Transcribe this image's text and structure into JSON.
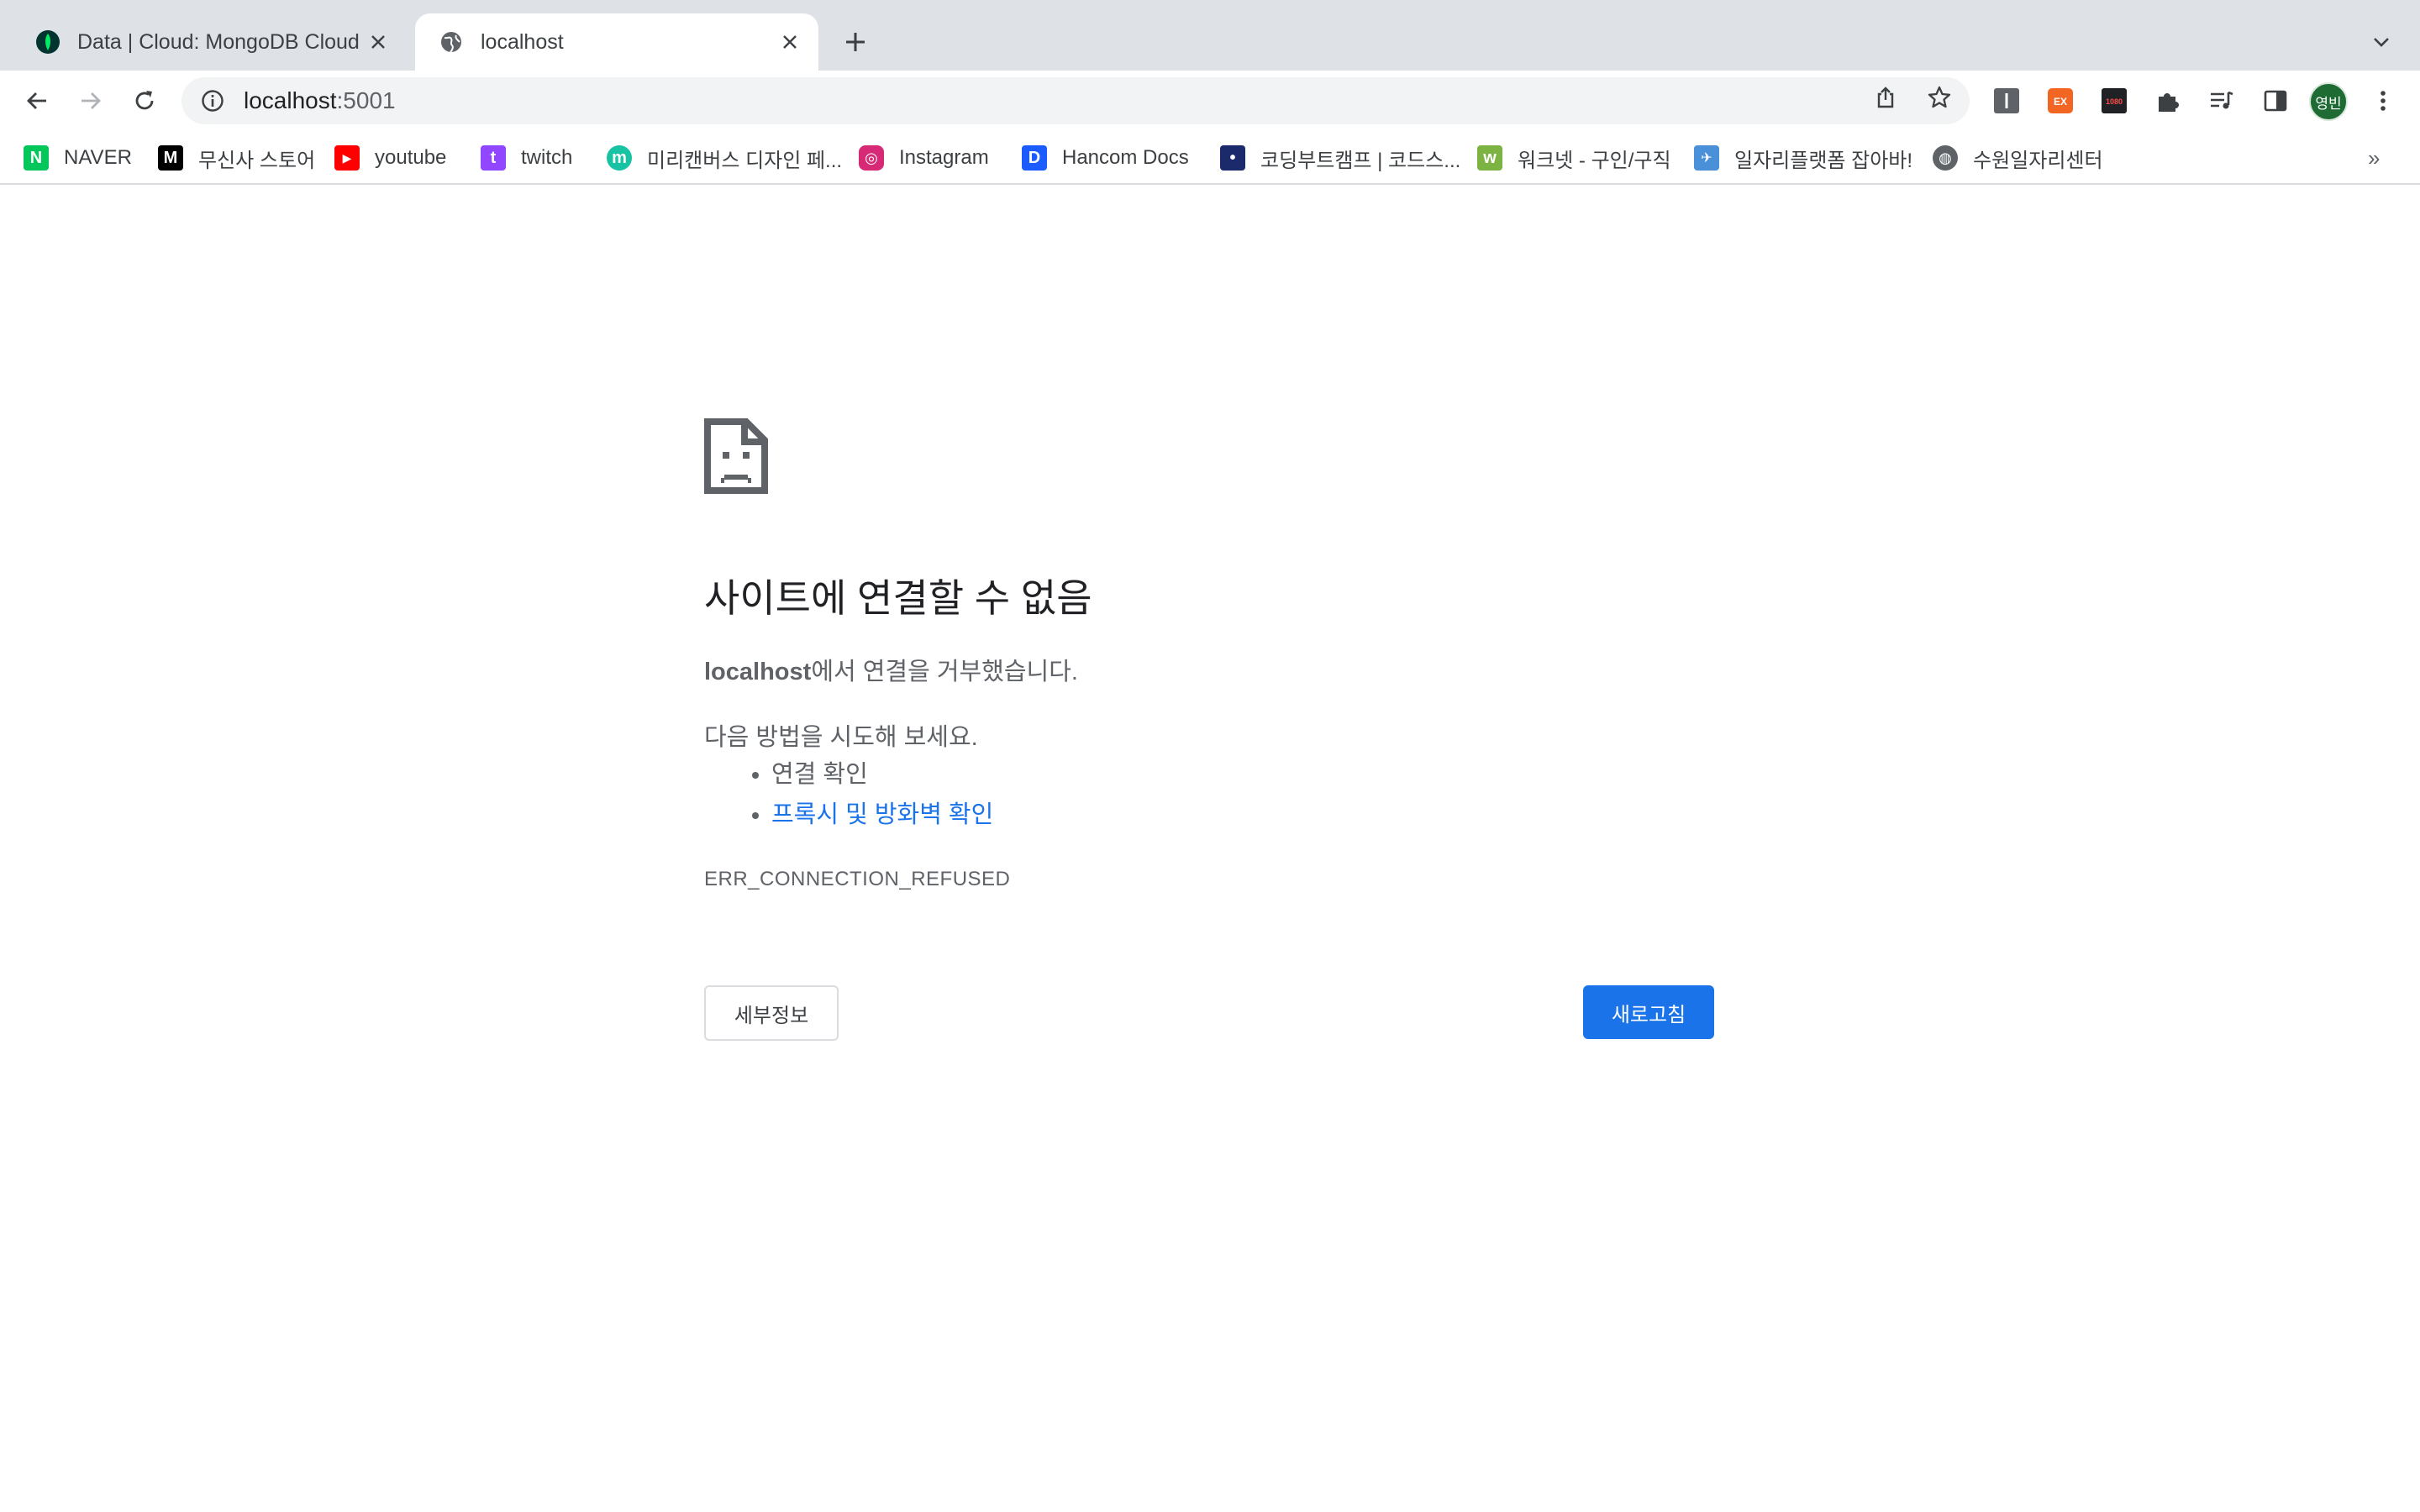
{
  "tabs": [
    {
      "title": "Data | Cloud: MongoDB Cloud",
      "favicon": "mongodb-leaf-icon",
      "active": false
    },
    {
      "title": "localhost",
      "favicon": "globe-icon",
      "active": true
    }
  ],
  "toolbar": {
    "url_host": "localhost",
    "url_port": ":5001"
  },
  "profile": {
    "initials": "영빈",
    "color": "#1e6b33"
  },
  "extensions": [
    {
      "name": "extension-i-icon",
      "label": "I"
    },
    {
      "name": "extension-ex-icon",
      "label": "EX"
    },
    {
      "name": "extension-1080-icon",
      "label": "1080"
    }
  ],
  "bookmarks": [
    {
      "label": "NAVER",
      "icon": "naver-icon",
      "color": "#03c75a",
      "glyph": "N"
    },
    {
      "label": "무신사 스토어",
      "icon": "musinsa-icon",
      "color": "#000000",
      "glyph": "M"
    },
    {
      "label": "youtube",
      "icon": "youtube-icon",
      "color": "#ff0000",
      "glyph": "▶"
    },
    {
      "label": "twitch",
      "icon": "twitch-icon",
      "color": "#9146ff",
      "glyph": "t"
    },
    {
      "label": "미리캔버스 디자인 페...",
      "icon": "miricanvas-icon",
      "color": "#17c3a3",
      "glyph": "m"
    },
    {
      "label": "Instagram",
      "icon": "instagram-icon",
      "color": "#d62976",
      "glyph": "◎"
    },
    {
      "label": "Hancom Docs",
      "icon": "hancom-docs-icon",
      "color": "#1a5cff",
      "glyph": "D"
    },
    {
      "label": "코딩부트캠프 | 코드스...",
      "icon": "codestates-icon",
      "color": "#1b2a6b",
      "glyph": "•"
    },
    {
      "label": "워크넷 - 구인/구직",
      "icon": "worknet-icon",
      "color": "#7cb342",
      "glyph": "w"
    },
    {
      "label": "일자리플랫폼 잡아바!",
      "icon": "jobaba-icon",
      "color": "#4a90d9",
      "glyph": "✈"
    },
    {
      "label": "수원일자리센터",
      "icon": "globe-icon",
      "color": "#5f6368",
      "glyph": "◍"
    }
  ],
  "bookmarks_more": "»",
  "error": {
    "heading": "사이트에 연결할 수 없음",
    "host": "localhost",
    "message_suffix": "에서 연결을 거부했습니다.",
    "try_label": "다음 방법을 시도해 보세요.",
    "suggestions": [
      "연결 확인",
      "프록시 및 방화벽 확인"
    ],
    "code": "ERR_CONNECTION_REFUSED",
    "details_button": "세부정보",
    "reload_button": "새로고침"
  },
  "colors": {
    "tabstrip_bg": "#dee1e6",
    "link": "#1a73e8",
    "primary_button": "#1a73e8"
  }
}
